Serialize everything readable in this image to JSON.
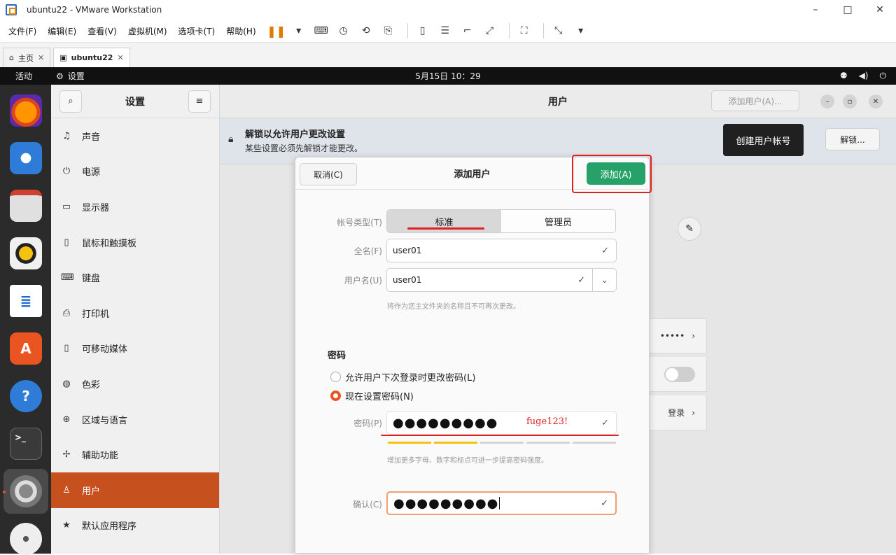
{
  "vmware": {
    "title": "ubuntu22 - VMware Workstation",
    "menu": [
      "文件(F)",
      "编辑(E)",
      "查看(V)",
      "虚拟机(M)",
      "选项卡(T)",
      "帮助(H)"
    ],
    "window_controls": {
      "minimize": "–",
      "maximize": "□",
      "close": "✕"
    },
    "tabs": [
      {
        "label": "主页",
        "close": "✕"
      },
      {
        "label": "ubuntu22",
        "close": "✕"
      }
    ]
  },
  "gnome": {
    "activities": "活动",
    "app_name": "设置",
    "clock": "5月15日  10：29"
  },
  "settings": {
    "sidebar_title": "设置",
    "items": [
      {
        "label": "声音",
        "icon": "music-note-icon"
      },
      {
        "label": "电源",
        "icon": "power-icon"
      },
      {
        "label": "显示器",
        "icon": "display-icon"
      },
      {
        "label": "鼠标和触摸板",
        "icon": "mouse-icon"
      },
      {
        "label": "键盘",
        "icon": "keyboard-icon"
      },
      {
        "label": "打印机",
        "icon": "printer-icon"
      },
      {
        "label": "可移动媒体",
        "icon": "removable-media-icon"
      },
      {
        "label": "色彩",
        "icon": "color-icon"
      },
      {
        "label": "区域与语言",
        "icon": "globe-icon"
      },
      {
        "label": "辅助功能",
        "icon": "accessibility-icon"
      },
      {
        "label": "用户",
        "icon": "user-icon",
        "active": true
      },
      {
        "label": "默认应用程序",
        "icon": "star-icon"
      }
    ]
  },
  "users_page": {
    "title": "用户",
    "add_user_button": "添加用户(A)...",
    "banner_title": "解锁以允许用户更改设置",
    "banner_subtitle": "某些设置必须先解锁才能更改。",
    "tooltip": "创建用户帐号",
    "unlock_button": "解锁...",
    "row_password": "•••••",
    "row_login": "登录"
  },
  "dialog": {
    "title": "添加用户",
    "cancel": "取消(C)",
    "add": "添加(A)",
    "account_type_label": "帐号类型(T)",
    "account_types": [
      "标准",
      "管理员"
    ],
    "selected_type": "标准",
    "fullname_label": "全名(F)",
    "fullname_value": "user01",
    "username_label": "用户名(U)",
    "username_value": "user01",
    "username_hint": "将作为您主文件夹的名称且不可再次更改。",
    "password_section": "密码",
    "radio_later": "允许用户下次登录时更改密码(L)",
    "radio_now": "现在设置密码(N)",
    "password_label": "密码(P)",
    "password_value": "●●●●●●●●●",
    "password_annotation": "fuge123!",
    "password_hint": "增加更多字母、数字和标点可进一步提高密码强度。",
    "confirm_label": "确认(C)",
    "confirm_value": "●●●●●●●●●",
    "strength_level": 0.4
  },
  "colors": {
    "accent": "#e95420",
    "add_green": "#26a269",
    "annotation_red": "#e02020"
  }
}
